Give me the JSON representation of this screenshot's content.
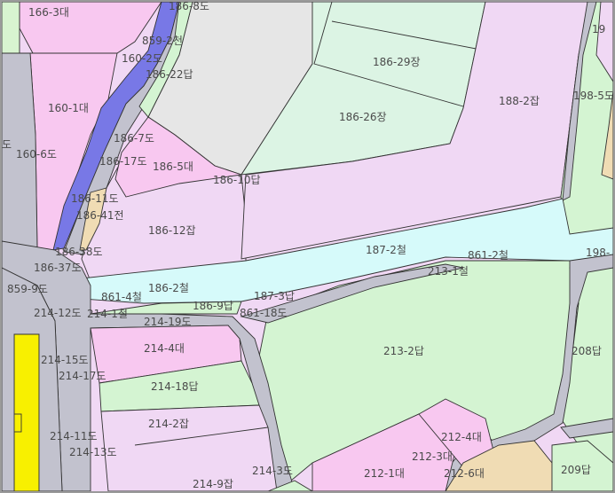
{
  "parcels": [
    {
      "id": "p1",
      "text": "166-3대"
    },
    {
      "id": "p2",
      "text": "186-8도"
    },
    {
      "id": "p3",
      "text": "859-2천"
    },
    {
      "id": "p4",
      "text": "160-2도"
    },
    {
      "id": "p5",
      "text": "186-22답"
    },
    {
      "id": "p6",
      "text": "160-1대"
    },
    {
      "id": "p7",
      "text": "186-7도"
    },
    {
      "id": "p8",
      "text": "160-6도"
    },
    {
      "id": "p9",
      "text": "186-17도"
    },
    {
      "id": "p10",
      "text": "186-5대"
    },
    {
      "id": "p11",
      "text": "186-10답"
    },
    {
      "id": "p12",
      "text": "186-11도"
    },
    {
      "id": "p13",
      "text": "186-41전"
    },
    {
      "id": "p14",
      "text": "186-12잡"
    },
    {
      "id": "p15",
      "text": "186-38도"
    },
    {
      "id": "p16",
      "text": "186-37도"
    },
    {
      "id": "p17",
      "text": "859-9도"
    },
    {
      "id": "p18",
      "text": "861-4철"
    },
    {
      "id": "p19",
      "text": "186-2철"
    },
    {
      "id": "p20",
      "text": "214-12도"
    },
    {
      "id": "p21",
      "text": "214-1철"
    },
    {
      "id": "p22",
      "text": "186-9답"
    },
    {
      "id": "p23",
      "text": "187-3답"
    },
    {
      "id": "p24",
      "text": "861-18도"
    },
    {
      "id": "p25",
      "text": "214-19도"
    },
    {
      "id": "p26",
      "text": "214-4대"
    },
    {
      "id": "p27",
      "text": "214-15도"
    },
    {
      "id": "p28",
      "text": "214-17도"
    },
    {
      "id": "p29",
      "text": "214-18답"
    },
    {
      "id": "p30",
      "text": "214-2잡"
    },
    {
      "id": "p31",
      "text": "214-11도"
    },
    {
      "id": "p32",
      "text": "214-13도"
    },
    {
      "id": "p33",
      "text": "214-3도"
    },
    {
      "id": "p34",
      "text": "214-9잡"
    },
    {
      "id": "p35",
      "text": "186-29장"
    },
    {
      "id": "p36",
      "text": "186-26장"
    },
    {
      "id": "p37",
      "text": "188-2잡"
    },
    {
      "id": "p38",
      "text": "187-2철"
    },
    {
      "id": "p39",
      "text": "861-2철"
    },
    {
      "id": "p40",
      "text": "213-1철"
    },
    {
      "id": "p41",
      "text": "213-2답"
    },
    {
      "id": "p42",
      "text": "212-4대"
    },
    {
      "id": "p43",
      "text": "212-3대"
    },
    {
      "id": "p44",
      "text": "212-1대"
    },
    {
      "id": "p45",
      "text": "212-6대"
    },
    {
      "id": "p46",
      "text": "208답"
    },
    {
      "id": "p47",
      "text": "209답"
    },
    {
      "id": "p48",
      "text": "198-"
    },
    {
      "id": "p49",
      "text": "198-5도"
    },
    {
      "id": "p50",
      "text": "19"
    },
    {
      "id": "p51",
      "text": "도"
    }
  ],
  "colors": {
    "residential": "#f8c8f0",
    "misc": "#f0d8f4",
    "paddy": "#d4f4d2",
    "factory": "#dcf4e4",
    "railway": "#d6fafa",
    "road": "#c2c2ce",
    "river": "#7878e6",
    "field": "#f0dcb4",
    "highlight": "#f8f000"
  }
}
